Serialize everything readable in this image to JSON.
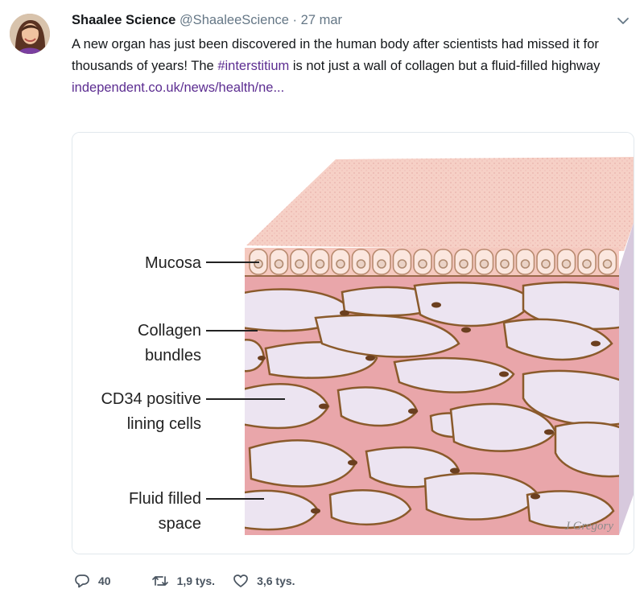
{
  "tweet": {
    "author_name": "Shaalee Science",
    "handle": "@ShaaleeScience",
    "separator": "·",
    "date": "27 mar",
    "text_before": "A new organ has just been discovered in the human body after scientists had missed it for thousands of years! The ",
    "hashtag": "#interstitium",
    "text_after": " is not just a wall of collagen but a fluid-filled highway",
    "link": "independent.co.uk/news/health/ne...",
    "replies": "40",
    "retweets": "1,9 tys.",
    "likes": "3,6 tys."
  },
  "figure": {
    "labels": {
      "mucosa": "Mucosa",
      "collagen_1": "Collagen",
      "collagen_2": "bundles",
      "cd34_1": "CD34 positive",
      "cd34_2": "lining cells",
      "fluid_1": "Fluid filled",
      "fluid_2": "space"
    },
    "signature": "J Gregory"
  },
  "colors": {
    "link": "#5c2d91",
    "tissue_pink": "#e9a6aa",
    "surface_pink": "#f6d0c6",
    "fluid_lavender": "#ece4f1",
    "cell_brown": "#8a5a2b"
  },
  "icons": [
    "chevron-down-icon",
    "reply-icon",
    "retweet-icon",
    "like-icon"
  ]
}
